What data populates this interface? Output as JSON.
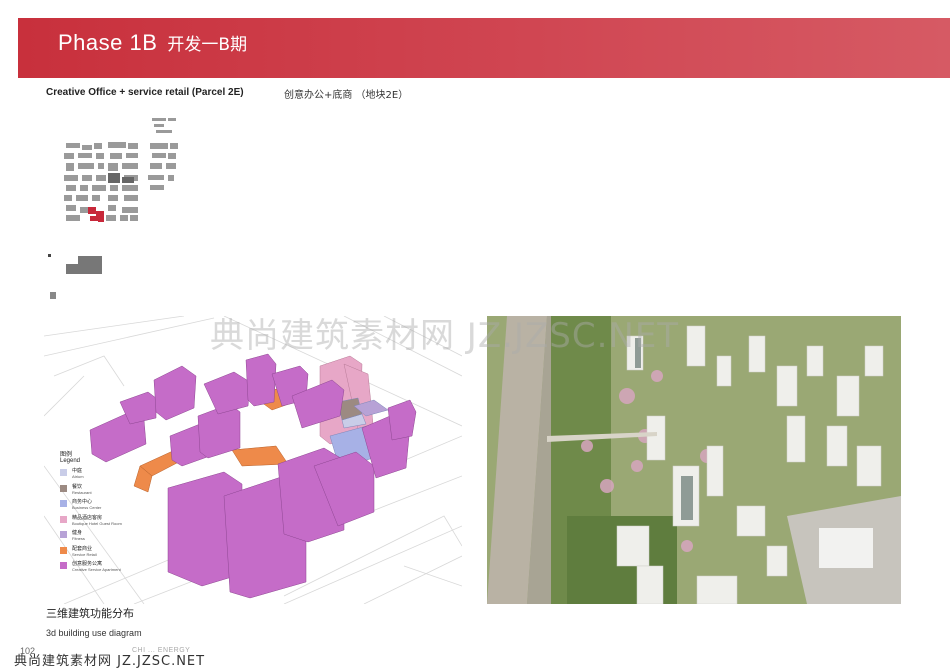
{
  "header": {
    "title_en": "Phase 1B",
    "title_cn": "开发一B期",
    "color": "#cf3f4b"
  },
  "subtitle": {
    "en": "Creative Office + service retail (Parcel 2E)",
    "cn": "创意办公+底商  （地块2E）"
  },
  "legend": {
    "title_cn": "图例",
    "title_en": "Legend",
    "items": [
      {
        "cn": "中庭",
        "en": "Atrium",
        "color": "#c9cde8"
      },
      {
        "cn": "餐饮",
        "en": "Restaurant",
        "color": "#9c8a82"
      },
      {
        "cn": "商务中心",
        "en": "Business Center",
        "color": "#a7b1e6"
      },
      {
        "cn": "精品酒店客房",
        "en": "Boutique Hotel Guest Room",
        "color": "#e7a7c7"
      },
      {
        "cn": "健身",
        "en": "Fitness",
        "color": "#b7a2d6"
      },
      {
        "cn": "配套商业",
        "en": "Service Retail",
        "color": "#ee8a4a"
      },
      {
        "cn": "创意服务公寓",
        "en": "Creative Service Apartment",
        "color": "#c56cc8"
      }
    ]
  },
  "caption": {
    "cn": "三维建筑功能分布",
    "en": "3d building use diagram"
  },
  "watermark": "典尚建筑素材网 JZ.JZSC.NET",
  "footer": {
    "page_number": "102",
    "text": "CHI  ...  ENERGY",
    "watermark": "典尚建筑素材网 JZ.JZSC.NET"
  }
}
